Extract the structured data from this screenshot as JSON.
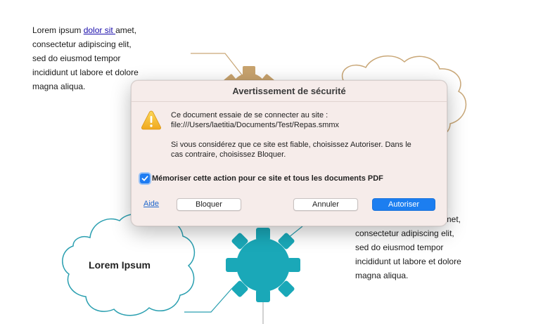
{
  "document": {
    "top_left_text": {
      "before_link": "Lorem ipsum ",
      "link": "dolor sit ",
      "after_link": "amet,",
      "lines": [
        "consectetur adipiscing elit,",
        "sed do eiusmod tempor",
        "incididunt ut labore et dolore",
        "magna aliqua."
      ]
    },
    "bottom_right_text": {
      "first_line": "amet,",
      "lines": [
        "consectetur adipiscing elit,",
        "sed do eiusmod tempor",
        "incididunt ut labore et dolore",
        "magna aliqua."
      ]
    },
    "cloud_label": "Lorem Ipsum",
    "colors": {
      "gear_top": "#c8a36e",
      "cloud_top_outline": "#c9a777",
      "gear_bottom": "#1aa8b8",
      "cloud_bottom_outline": "#2a9fb0",
      "connector_line": "#b3b3b3"
    }
  },
  "dialog": {
    "title": "Avertissement de sécurité",
    "icon": "warning-triangle-icon",
    "message_line1": "Ce document essaie de se connecter au site :",
    "message_line2": "file:///Users/laetitia/Documents/Test/Repas.smmx",
    "message_line3": "Si vous considérez que ce site est fiable, choisissez Autoriser. Dans le",
    "message_line4": "cas contraire, choisissez Bloquer.",
    "remember_label": "Mémoriser cette action pour ce site et tous les documents PDF",
    "remember_checked": true,
    "help_label": "Aide",
    "block_label": "Bloquer",
    "cancel_label": "Annuler",
    "allow_label": "Autoriser",
    "accent_color": "#1c7ef0"
  }
}
